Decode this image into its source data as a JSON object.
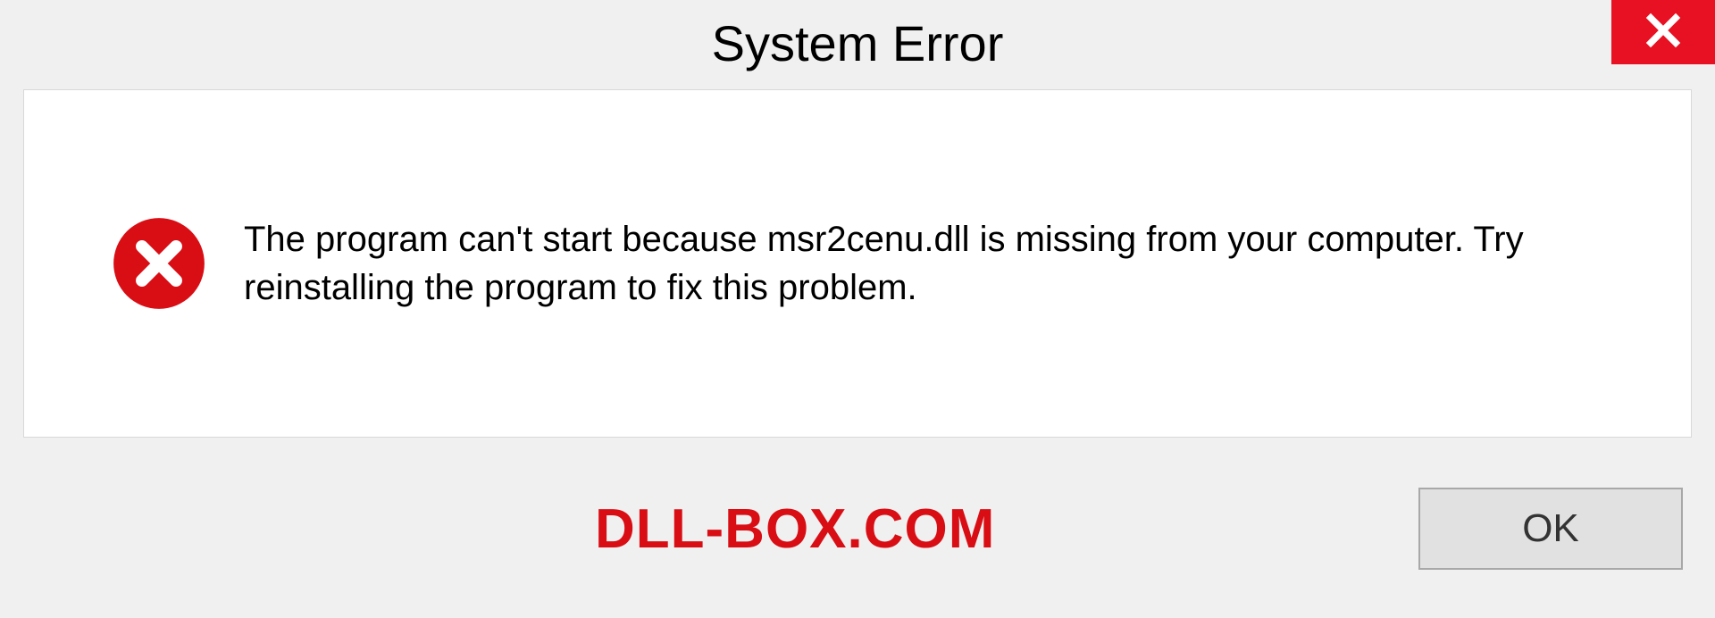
{
  "titlebar": {
    "title": "System Error"
  },
  "dialog": {
    "message": "The program can't start because msr2cenu.dll is missing from your computer. Try reinstalling the program to fix this problem."
  },
  "footer": {
    "watermark": "DLL-BOX.COM",
    "ok_label": "OK"
  },
  "colors": {
    "close_red": "#e81123",
    "error_red": "#d90e15",
    "watermark_red": "#d90e15"
  }
}
